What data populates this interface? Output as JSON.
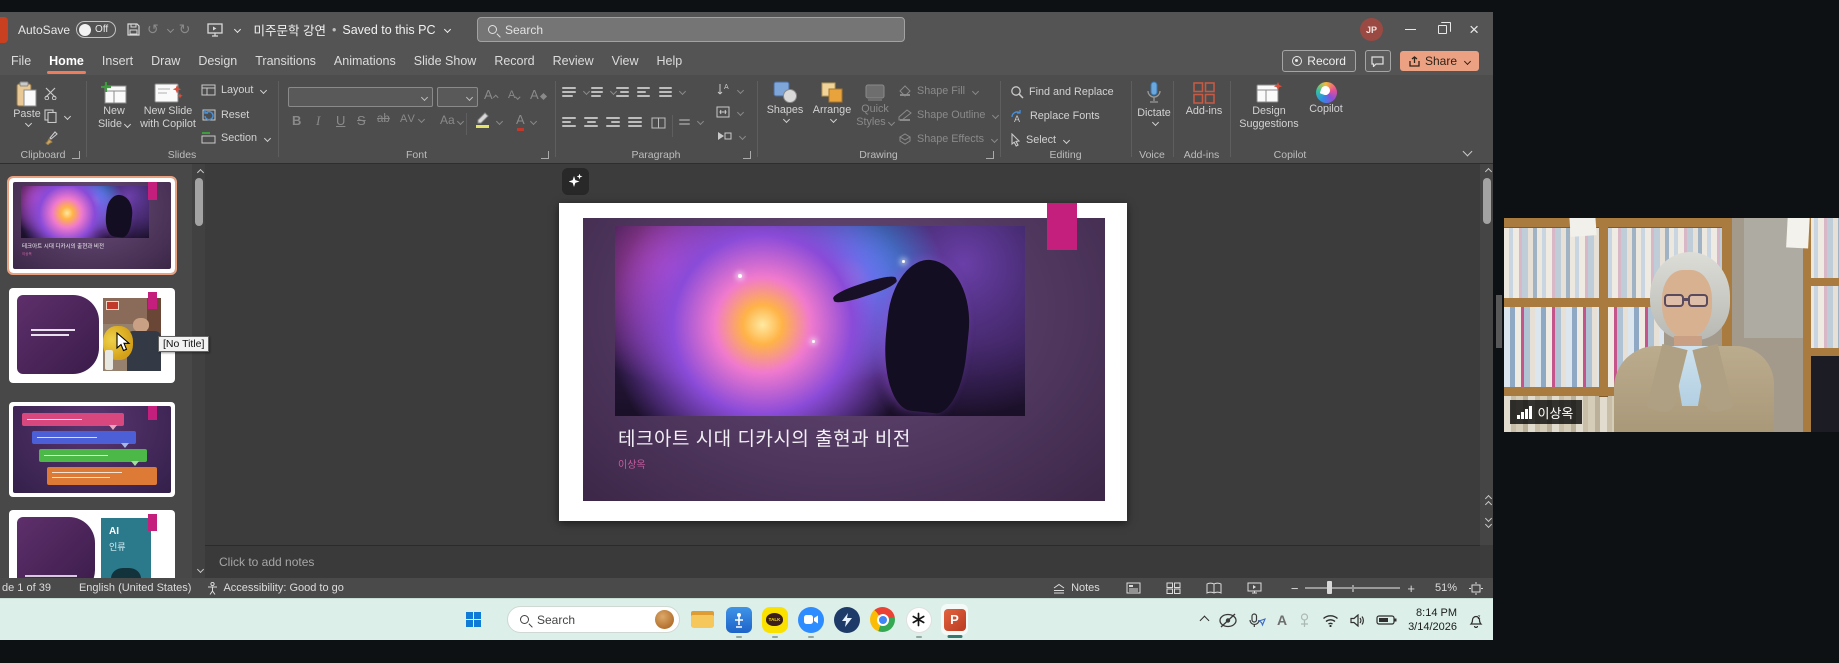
{
  "titlebar": {
    "autosave": "AutoSave",
    "autosave_state": "Off",
    "doc_title": "미주문학 강연",
    "separator": "•",
    "saved_status": "Saved to this PC",
    "search_placeholder": "Search",
    "avatar": "JP"
  },
  "tabs": {
    "items": [
      "File",
      "Home",
      "Insert",
      "Draw",
      "Design",
      "Transitions",
      "Animations",
      "Slide Show",
      "Record",
      "Review",
      "View",
      "Help"
    ],
    "active": "Home",
    "record": "Record",
    "share": "Share"
  },
  "ribbon": {
    "clipboard": {
      "label": "Clipboard",
      "paste": "Paste"
    },
    "slides": {
      "label": "Slides",
      "new_1": "New",
      "new_2": "Slide",
      "cop_1": "New Slide",
      "cop_2": "with Copilot",
      "layout": "Layout",
      "reset": "Reset",
      "section": "Section"
    },
    "font": {
      "label": "Font",
      "bold": "B",
      "italic": "I",
      "underline": "U",
      "strike": "S",
      "strike2": "ab",
      "spacing": "AV",
      "case": "Aa",
      "grow": "A",
      "shrink": "A",
      "clear": "A",
      "color": "A"
    },
    "paragraph": {
      "label": "Paragraph"
    },
    "drawing": {
      "label": "Drawing",
      "shapes": "Shapes",
      "arrange": "Arrange",
      "quick_1": "Quick",
      "quick_2": "Styles",
      "fill": "Shape Fill",
      "outline": "Shape Outline",
      "effects": "Shape Effects"
    },
    "editing": {
      "label": "Editing",
      "find": "Find and Replace",
      "replace": "Replace Fonts",
      "select": "Select"
    },
    "voice": {
      "label": "Voice",
      "dictate": "Dictate"
    },
    "addins": {
      "label": "Add-ins",
      "button": "Add-ins"
    },
    "copilot": {
      "label": "Copilot",
      "design_1": "Design",
      "design_2": "Suggestions",
      "button": "Copilot"
    }
  },
  "panel": {
    "tooltip": "[No Title]",
    "thumb1": {
      "title": "테크아트 시대 디카시의 출현과 비전",
      "subtitle": "이상옥"
    },
    "thumb4": {
      "book_1": "AI",
      "book_2": "인류"
    }
  },
  "slide": {
    "title": "테크아트 시대 디카시의 출현과 비전",
    "subtitle": "이상옥"
  },
  "notes": {
    "placeholder": "Click to add notes"
  },
  "statusbar": {
    "slide_info": "de 1 of 39",
    "language": "English (United States)",
    "accessibility": "Accessibility: Good to go",
    "notes": "Notes",
    "zoom": "51%"
  },
  "taskbar": {
    "search_placeholder": "Search",
    "ime": "A",
    "time": "8:14 PM",
    "date": "3/14/2026"
  },
  "webcam": {
    "name": "이상옥"
  },
  "colors": {
    "accent": "#ED7D5C",
    "share_button": "#EDA183",
    "magenta_accent": "#C51F7E",
    "taskbar_bg": "#DCEFE8"
  }
}
